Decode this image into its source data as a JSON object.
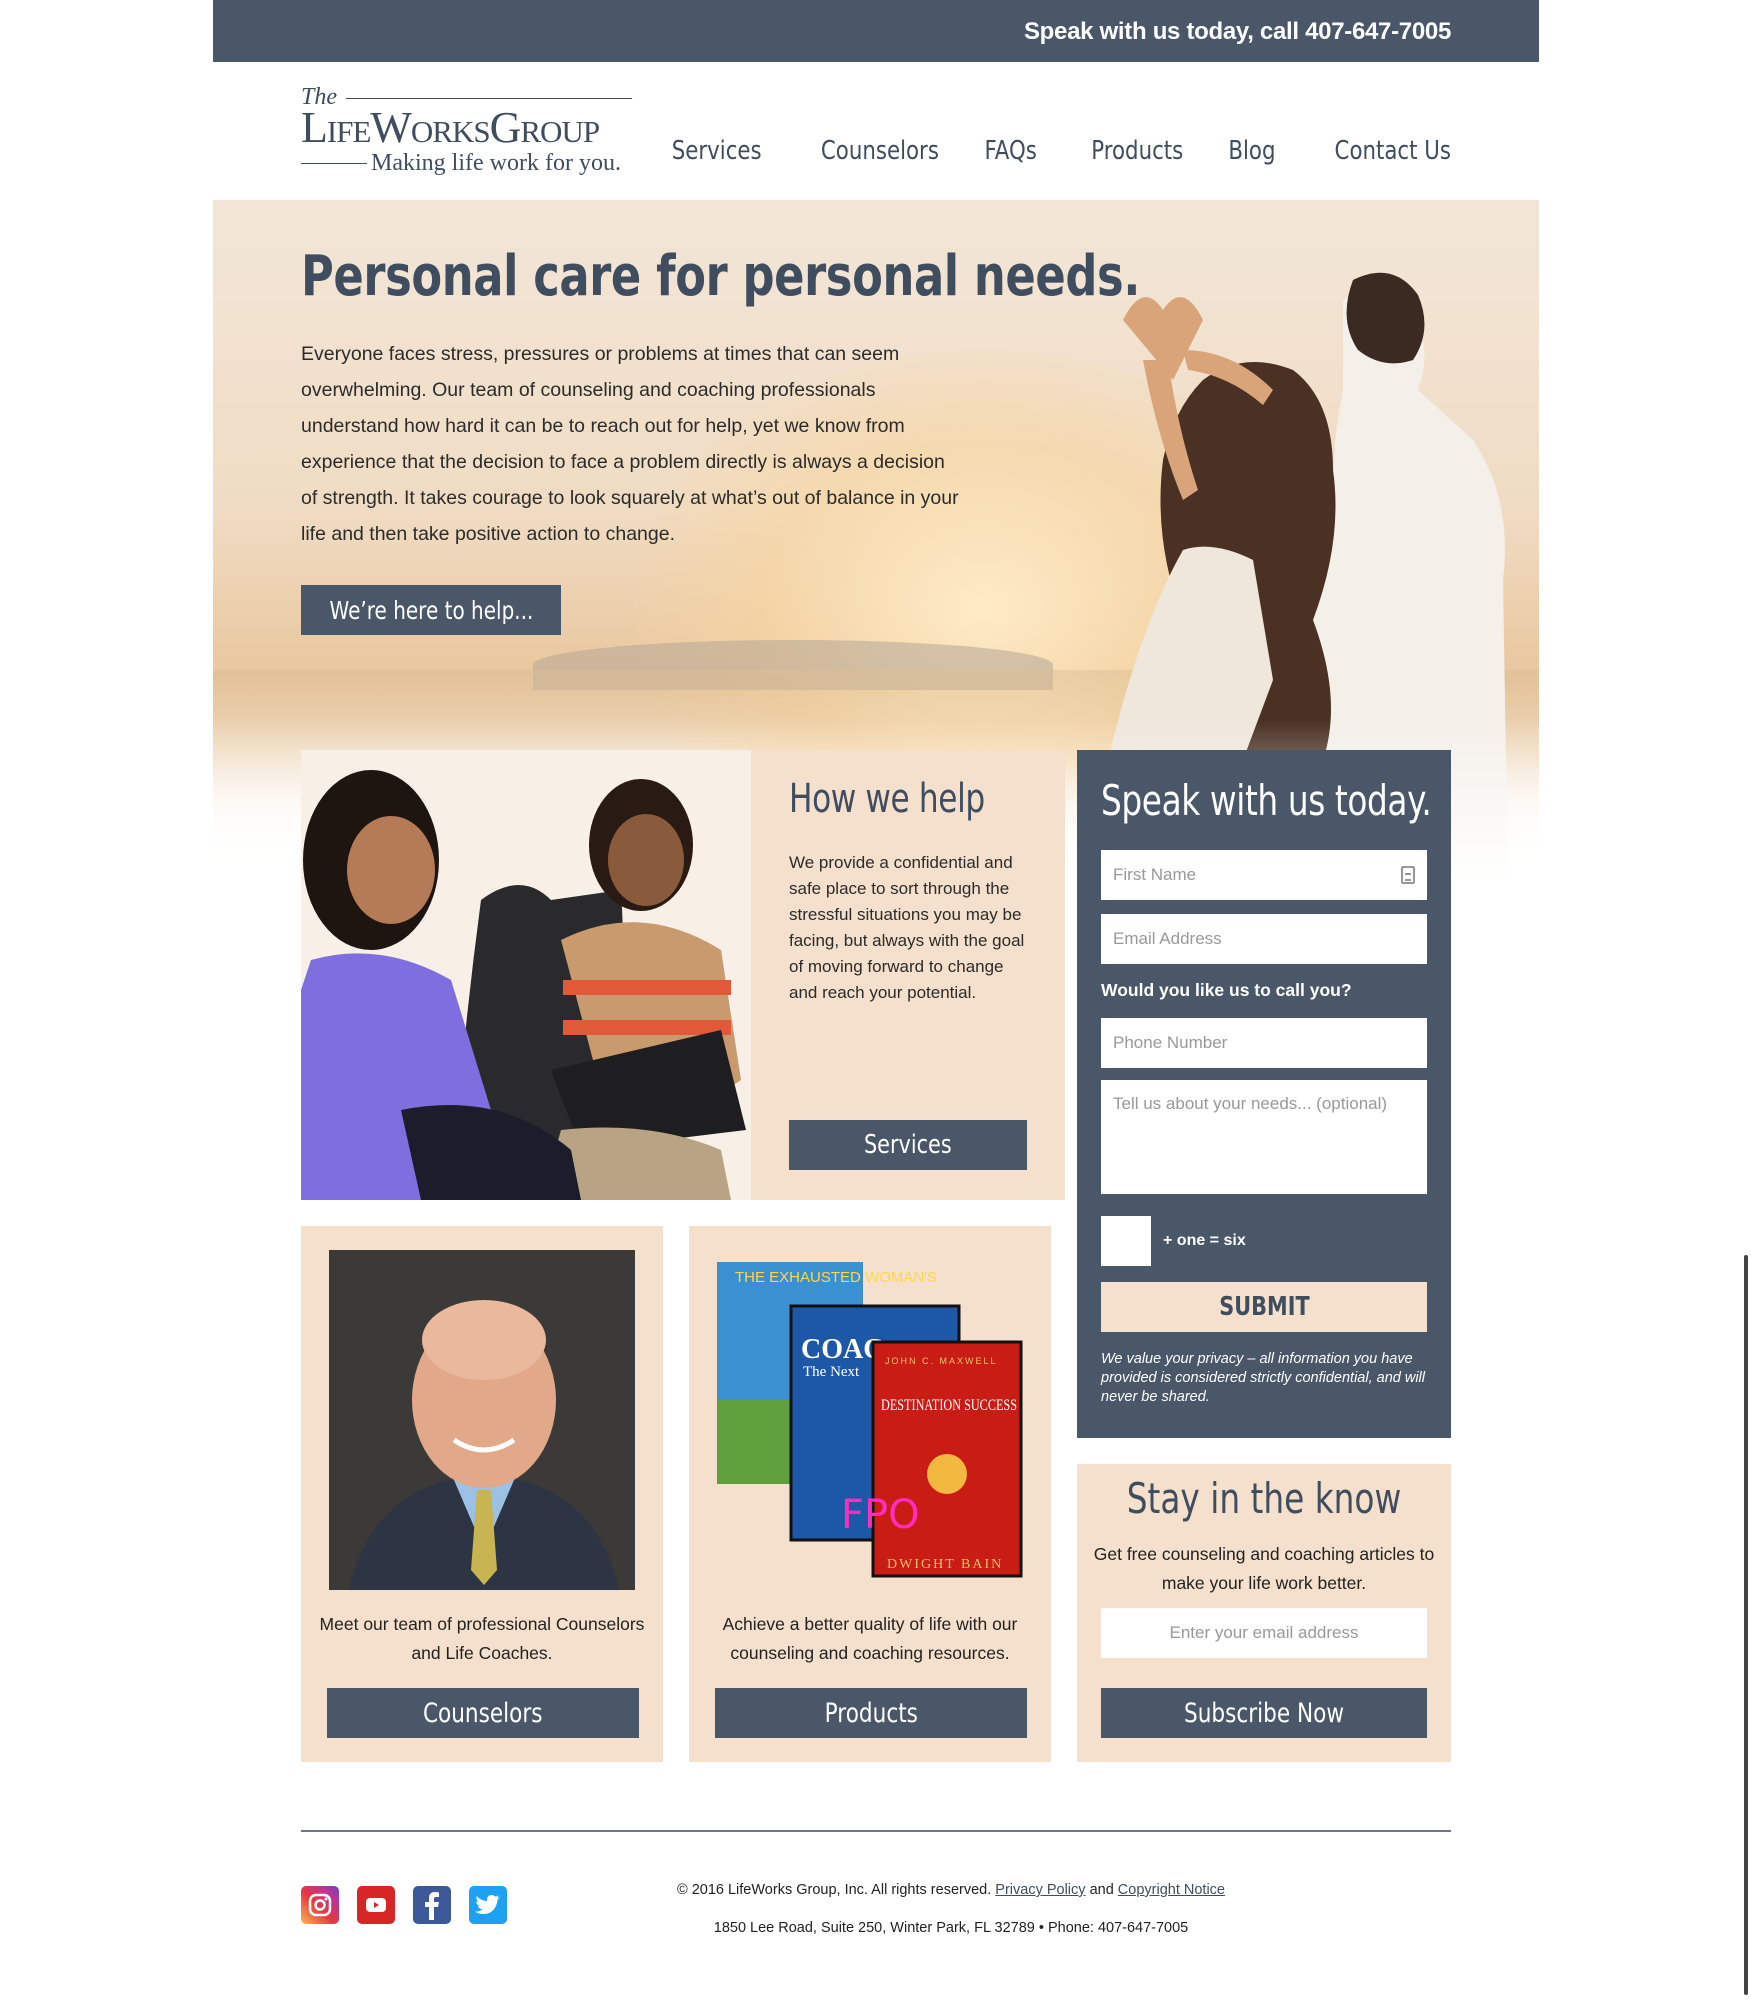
{
  "topbar": {
    "phone_text": "Speak with us today, call 407-647-7005"
  },
  "logo": {
    "the": "The",
    "name": "LifeWorksGroup",
    "tagline": "Making life work for you."
  },
  "nav": {
    "items": [
      "Services",
      "Counselors",
      "FAQs",
      "Products",
      "Blog",
      "Contact Us"
    ]
  },
  "hero": {
    "heading": "Personal care for personal needs.",
    "body": "Everyone faces stress, pressures or problems at times that can seem overwhelming. Our team of counseling and coaching professionals understand how hard it can be to reach out for help, yet we know from experience that the decision to face a problem directly is always a decision of strength. It takes courage to look squarely at what’s out of balance in your life and then take positive action to change.",
    "button": "We’re here to help..."
  },
  "how": {
    "heading": "How we help",
    "body": "We provide a confidential and safe place to sort through the stressful situations you may be facing, but always with the goal of moving forward to change and reach your potential.",
    "button": "Services"
  },
  "counselors_card": {
    "text": "Meet our team of professional Counselors and Life Coaches.",
    "button": "Counselors"
  },
  "products_card": {
    "text": "Achieve a better quality of life with our counseling and coaching resources.",
    "button": "Products",
    "book1": "THE EXHAUSTED WOMAN'S",
    "book2": "COAC",
    "book2_sub": "The Next",
    "book3_author": "JOHN C. MAXWELL",
    "book3_title": "DESTINATION SUCCESS",
    "book3_bottom": "DWIGHT BAIN",
    "fpo": "FPO"
  },
  "form": {
    "heading": "Speak with us today.",
    "first_name_placeholder": "First Name",
    "email_placeholder": "Email Address",
    "call_question": "Would you like us to call you?",
    "phone_placeholder": "Phone Number",
    "needs_placeholder": "Tell us about your needs... (optional)",
    "captcha_text": "+ one = six",
    "submit": "SUBMIT",
    "privacy": "We value your privacy – all information you have provided is considered strictly confidential, and will never be shared."
  },
  "newsletter": {
    "heading": "Stay in the know",
    "body": "Get free counseling and coaching articles to make your life work better.",
    "email_placeholder": "Enter your email address",
    "button": "Subscribe Now"
  },
  "footer": {
    "copyright": "© 2016 LifeWorks Group, Inc. All rights reserved.",
    "privacy_link": "Privacy Policy",
    "and": "and",
    "copyright_link": "Copyright Notice",
    "address": "1850 Lee Road, Suite 250, Winter Park, FL 32789 • Phone: 407-647-7005",
    "social": [
      "instagram-icon",
      "youtube-icon",
      "facebook-icon",
      "twitter-icon"
    ]
  },
  "colors": {
    "slate": "#4a5768",
    "peach": "#f4e0cc",
    "heading": "#3f4d5e"
  }
}
